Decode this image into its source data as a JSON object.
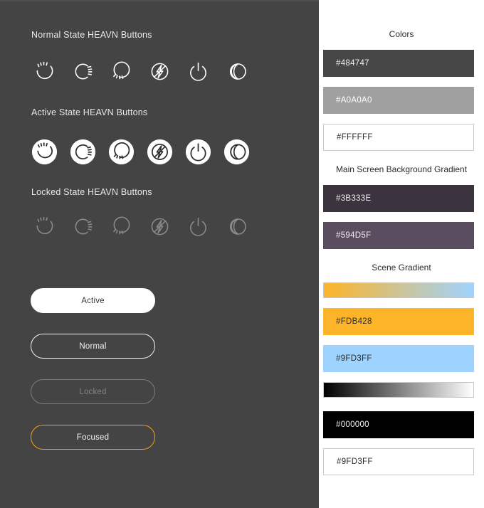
{
  "left": {
    "sections": [
      {
        "title": "Normal State HEAVN Buttons",
        "state": "normal"
      },
      {
        "title": "Active State HEAVN Buttons",
        "state": "active"
      },
      {
        "title": "Locked State HEAVN Buttons",
        "state": "locked"
      }
    ],
    "icons": [
      "high-beam-icon",
      "side-beam-icon",
      "down-beam-icon",
      "hazard-lightning-icon",
      "power-icon",
      "moon-icon"
    ],
    "buttons": [
      {
        "label": "Active",
        "state": "active"
      },
      {
        "label": "Normal",
        "state": "normal"
      },
      {
        "label": "Locked",
        "state": "locked"
      },
      {
        "label": "Focused",
        "state": "focused"
      }
    ]
  },
  "right": {
    "groups": [
      {
        "title": "Colors"
      },
      {
        "title": "Main Screen Background Gradient"
      },
      {
        "title": "Scene Gradient"
      }
    ],
    "swatches": [
      {
        "label": "#484747",
        "fill": "#484747",
        "text": "#f0f0f0",
        "outlined": false
      },
      {
        "label": "#A0A0A0",
        "fill": "#A0A0A0",
        "text": "#ffffff",
        "outlined": false
      },
      {
        "label": "#FFFFFF",
        "fill": "#FFFFFF",
        "text": "#2b2b2b",
        "outlined": true
      },
      {
        "label": "#3B333E",
        "fill": "#3B333E",
        "text": "#f0f0f0",
        "outlined": false
      },
      {
        "label": "#594D5F",
        "fill": "#594D5F",
        "text": "#f0f0f0",
        "outlined": false
      },
      {
        "label": "#FDB428",
        "fill": "#FDB428",
        "text": "#2b2b2b",
        "outlined": false
      },
      {
        "label": "#9FD3FF",
        "fill": "#9FD3FF",
        "text": "#2b2b2b",
        "outlined": false
      },
      {
        "label": "#000000",
        "fill": "#000000",
        "text": "#f0f0f0",
        "outlined": false
      },
      {
        "label": "#9FD3FF",
        "fill": "#FFFFFF",
        "text": "#2b2b2b",
        "outlined": true
      }
    ],
    "gradients": [
      {
        "name": "scene-gradient-bar",
        "from": "#FDB428",
        "to": "#9FD3FF"
      },
      {
        "name": "grayscale-gradient-bar",
        "from": "#000000",
        "to": "#FFFFFF"
      }
    ]
  },
  "colors": {
    "panel_background": "#444444",
    "accent_focus": "#F0A11E",
    "icon_normal": "#FFFFFF",
    "icon_locked": "#8A8A8A"
  }
}
